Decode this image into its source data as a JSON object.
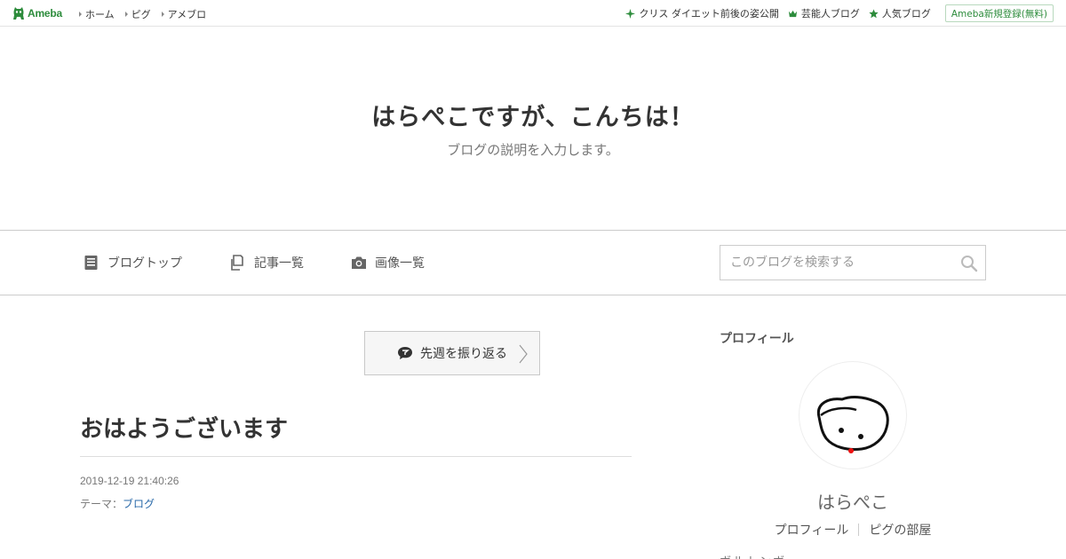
{
  "topbar": {
    "logo_text": "Ameba",
    "nav": [
      {
        "label": "ホーム"
      },
      {
        "label": "ピグ"
      },
      {
        "label": "アメブロ"
      }
    ],
    "right_links": [
      {
        "label": "クリス ダイエット前後の姿公開",
        "icon": "sparkle-icon"
      },
      {
        "label": "芸能人ブログ",
        "icon": "crown-icon"
      },
      {
        "label": "人気ブログ",
        "icon": "star-icon"
      }
    ],
    "signup_label": "Ameba新規登録(無料)"
  },
  "blog": {
    "title": "はらぺこですが、こんちは！",
    "description": "ブログの説明を入力します。"
  },
  "gnav": {
    "items": [
      {
        "label": "ブログトップ",
        "icon": "document-icon"
      },
      {
        "label": "記事一覧",
        "icon": "copy-icon"
      },
      {
        "label": "画像一覧",
        "icon": "camera-icon"
      }
    ],
    "search_placeholder": "このブログを検索する"
  },
  "main": {
    "lookback_label": "先週を振り返る",
    "entry": {
      "title": "おはようございます",
      "date": "2019-12-19 21:40:26",
      "theme_prefix": "テーマ：",
      "theme_link": "ブログ"
    }
  },
  "sidebar": {
    "heading": "プロフィール",
    "name": "はらぺこ",
    "links": [
      {
        "label": "プロフィール"
      },
      {
        "label": "ピグの部屋"
      }
    ],
    "cut_text": "ボルトンボ"
  },
  "colors": {
    "brand_green": "#2d8c3c",
    "link_blue": "#2868a8",
    "border": "#cccccc"
  }
}
